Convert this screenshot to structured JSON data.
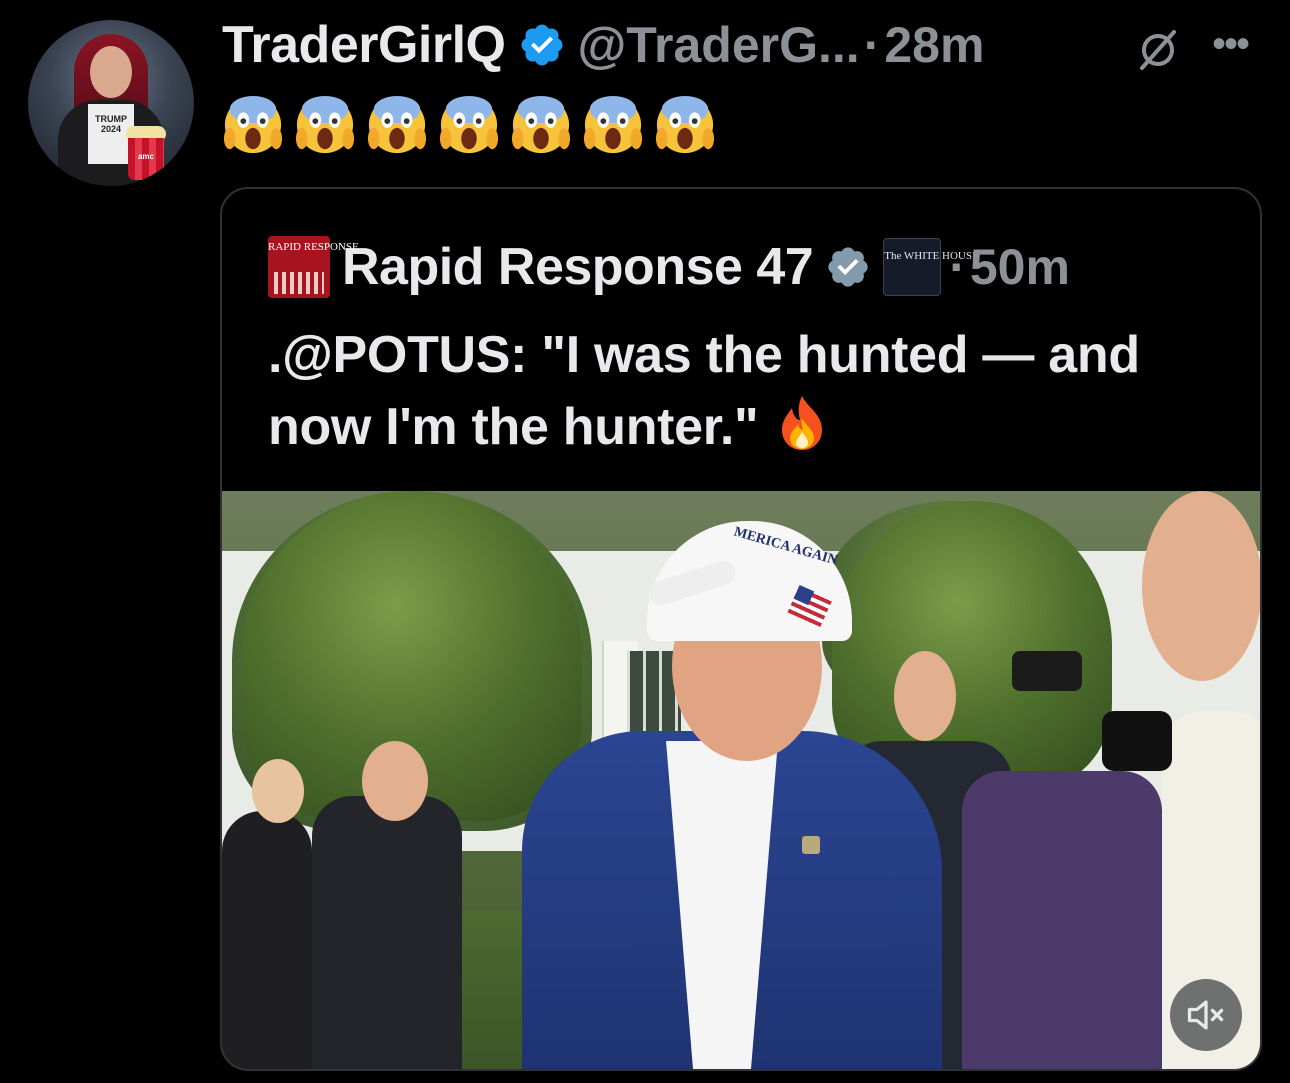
{
  "post": {
    "author_name": "TraderGirlQ",
    "handle": "@TraderG...",
    "separator": "·",
    "time": "28m",
    "emojis": [
      "😱",
      "😱",
      "😱",
      "😱",
      "😱",
      "😱",
      "😱"
    ],
    "avatar_shirt_text": "TRUMP 2024",
    "avatar_bucket_text": "amc"
  },
  "icons": {
    "verified": "verified-badge-icon",
    "grok": "grok-icon",
    "more": "more-options-icon",
    "mute": "mute-icon"
  },
  "quote": {
    "author_name": "Rapid Response 47",
    "logo_text": "RAPID RESPONSE",
    "affiliation_badge_text": "The WHITE HOUSE",
    "separator": "·",
    "time": "50m",
    "text": ".@POTUS: \"I was the hunted — and now I'm the hunter.\"",
    "emoji": "🔥",
    "media": {
      "hat_text": "MERICA AGAIN"
    }
  },
  "colors": {
    "background": "#000000",
    "text_primary": "#e7e9ea",
    "text_secondary": "#8b9196",
    "verified_blue": "#1d9bf0",
    "border": "#2f3336"
  }
}
